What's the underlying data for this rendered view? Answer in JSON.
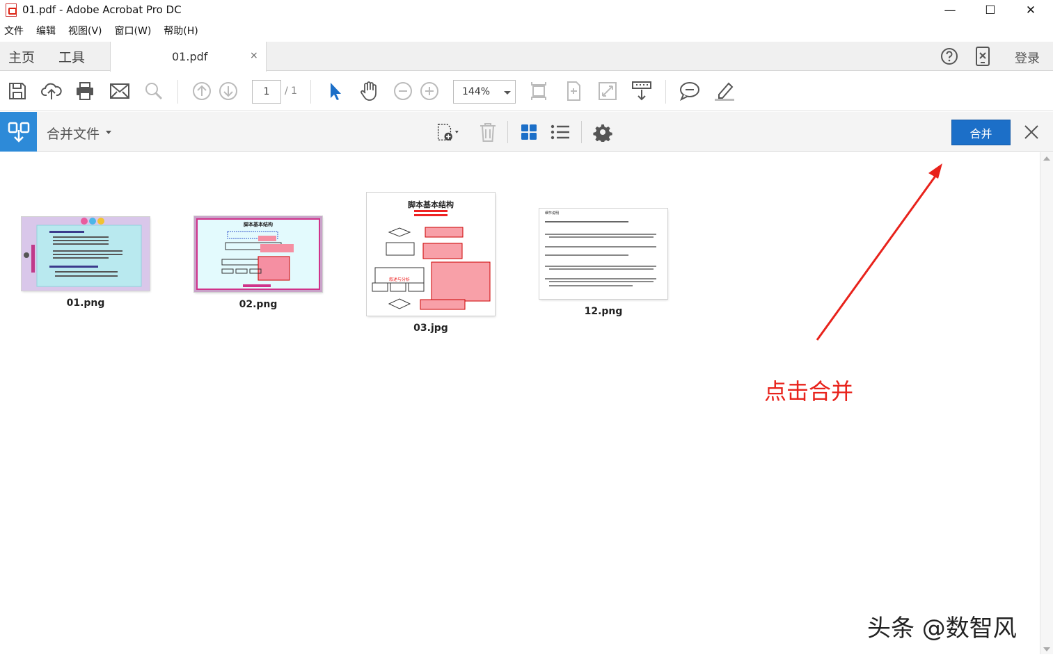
{
  "window": {
    "title": "01.pdf - Adobe Acrobat Pro DC",
    "minimize": "—",
    "maximize": "☐",
    "close": "✕"
  },
  "menu": [
    "文件",
    "编辑",
    "视图(V)",
    "窗口(W)",
    "帮助(H)"
  ],
  "tabs": {
    "home": "主页",
    "tools": "工具",
    "document": "01.pdf",
    "document_close": "×",
    "login": "登录"
  },
  "toolbar": {
    "page_current": "1",
    "page_total": "/ 1",
    "zoom": "144%"
  },
  "combine": {
    "title": "合并文件",
    "merge_button": "合并"
  },
  "files": [
    {
      "name": "01.png"
    },
    {
      "name": "02.png"
    },
    {
      "name": "03.jpg"
    },
    {
      "name": "12.png"
    }
  ],
  "thumbnail_text": {
    "t02_title": "脚本基本结构",
    "t03_title": "脚本基本结构",
    "t03_analysis": "叙述与分析",
    "t04_title": "细节说明"
  },
  "annotation": "点击合并",
  "watermark": "头条 @数智风",
  "colors": {
    "accent_blue": "#1c6fc8",
    "combine_icon_bg": "#2d8ad8",
    "annotation_red": "#e8221b"
  }
}
